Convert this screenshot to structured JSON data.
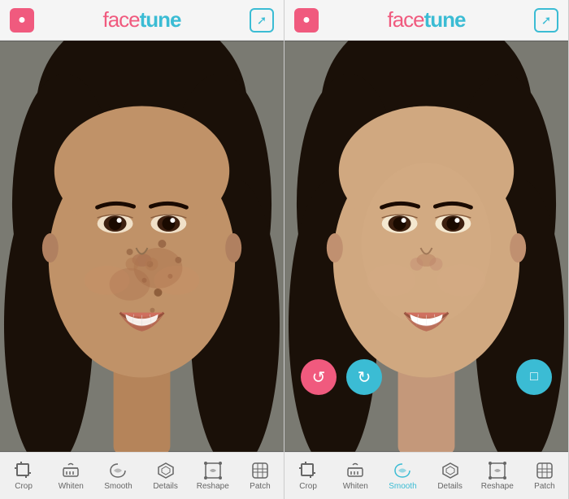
{
  "app": {
    "name_face": "face",
    "name_tune": "tune"
  },
  "panels": [
    {
      "id": "before",
      "header": {
        "logo_face": "face",
        "logo_tune": "tune",
        "camera_label": "camera",
        "share_label": "share"
      },
      "toolbar": {
        "items": [
          {
            "id": "crop",
            "label": "Crop",
            "icon": "crop"
          },
          {
            "id": "whiten",
            "label": "Whiten",
            "icon": "whiten"
          },
          {
            "id": "smooth",
            "label": "Smooth",
            "icon": "smooth"
          },
          {
            "id": "details",
            "label": "Details",
            "icon": "details"
          },
          {
            "id": "reshape",
            "label": "Reshape",
            "icon": "reshape"
          },
          {
            "id": "patch",
            "label": "Patch",
            "icon": "patch"
          }
        ]
      }
    },
    {
      "id": "after",
      "header": {
        "logo_face": "face",
        "logo_tune": "tune",
        "camera_label": "camera",
        "share_label": "share"
      },
      "action_buttons": [
        {
          "id": "undo",
          "label": "↺",
          "color": "#f05a7e"
        },
        {
          "id": "redo",
          "label": "↻",
          "color": "#3bbcd4"
        },
        {
          "id": "copy",
          "label": "⧉",
          "color": "#3bbcd4"
        }
      ],
      "toolbar": {
        "items": [
          {
            "id": "crop",
            "label": "Crop",
            "icon": "crop"
          },
          {
            "id": "whiten",
            "label": "Whiten",
            "icon": "whiten"
          },
          {
            "id": "smooth",
            "label": "Smooth",
            "icon": "smooth",
            "active": true
          },
          {
            "id": "details",
            "label": "Details",
            "icon": "details"
          },
          {
            "id": "reshape",
            "label": "Reshape",
            "icon": "reshape"
          },
          {
            "id": "patch",
            "label": "Patch",
            "icon": "patch"
          }
        ]
      }
    }
  ],
  "colors": {
    "pink": "#f05a7e",
    "teal": "#3bbcd4",
    "toolbar_bg": "#f0f0f0",
    "header_bg": "#f5f5f5"
  }
}
